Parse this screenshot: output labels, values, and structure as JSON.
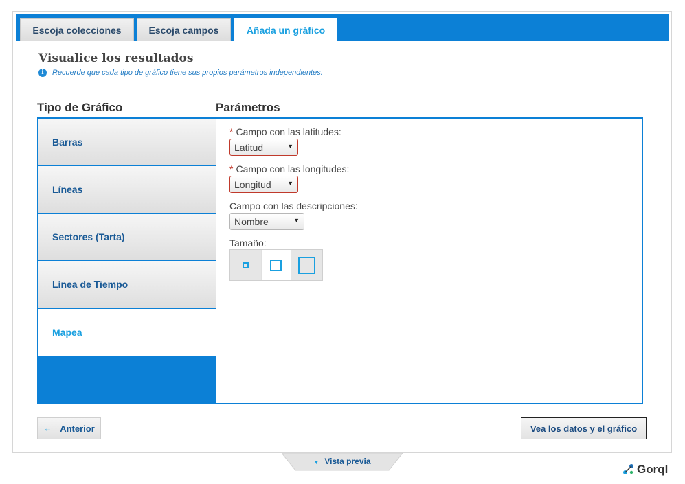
{
  "tabs": [
    {
      "label": "Escoja colecciones",
      "active": false
    },
    {
      "label": "Escoja campos",
      "active": false
    },
    {
      "label": "Añada un gráfico",
      "active": true
    }
  ],
  "section": {
    "title": "Visualice los resultados",
    "hint": "Recuerde que cada tipo de gráfico tiene sus propios parámetros independientes."
  },
  "chart_types": {
    "heading": "Tipo de Gráfico",
    "items": [
      {
        "label": "Barras",
        "active": false
      },
      {
        "label": "Líneas",
        "active": false
      },
      {
        "label": "Sectores (Tarta)",
        "active": false
      },
      {
        "label": "Línea de Tiempo",
        "active": false
      },
      {
        "label": "Mapea",
        "active": true
      }
    ]
  },
  "params": {
    "heading": "Parámetros",
    "latitudes": {
      "label": "Campo con las latitudes:",
      "required_mark": "*",
      "value": "Latitud"
    },
    "longitudes": {
      "label": "Campo con las longitudes:",
      "required_mark": "*",
      "value": "Longitud"
    },
    "descripciones": {
      "label": "Campo con las descripciones:",
      "value": "Nombre"
    },
    "tamano": {
      "label": "Tamaño:",
      "options": [
        "small",
        "medium",
        "large"
      ],
      "selected": "medium"
    }
  },
  "buttons": {
    "prev": "Anterior",
    "next": "Vea los datos y el gráfico",
    "preview": "Vista previa"
  },
  "logo": {
    "text": "Gorql"
  },
  "icons": {
    "info": "info-icon",
    "prev_arrow": "arrow-left-icon",
    "dropdown": "chevron-down-icon",
    "preview_toggle": "triangle-down-icon",
    "logo": "gorql-logo-icon"
  },
  "colors": {
    "accent": "#0c80d6",
    "active_text": "#1aa0e0",
    "link": "#1a5a96",
    "error": "#c0392b"
  }
}
